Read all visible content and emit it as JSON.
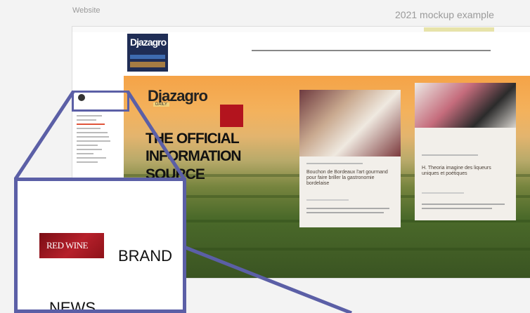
{
  "captions": {
    "left": "Website",
    "right": "2021 mockup example"
  },
  "site": {
    "logo_text": "Djazagro",
    "nav_items": [
      "",
      "",
      "",
      "",
      "",
      ""
    ],
    "daily_logo": "Djazagro",
    "daily_sub": "DAILY",
    "headline": [
      "THE OFFICIAL",
      "INFORMATION",
      "SOURCE"
    ]
  },
  "cards": [
    {
      "title": "Bouchon de Bordeaux l'art gourmand pour faire briller la gastronomie bordelaise"
    },
    {
      "title": "H. Theoria imagine des liqueurs uniques et poétiques"
    }
  ],
  "zoom": {
    "logo_text": "RED WINE",
    "brand_label": "BRAND",
    "news_label": "NEWS"
  },
  "colors": {
    "accent": "#5b5fa6",
    "brand_navy": "#1f2d55",
    "red_wine": "#b6202b"
  }
}
